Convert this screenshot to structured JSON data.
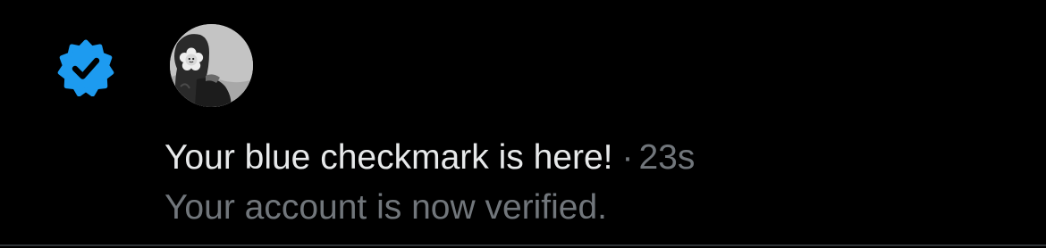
{
  "notification": {
    "icon": "verified-badge-icon",
    "avatar": "user-avatar",
    "title": "Your blue checkmark is here!",
    "separator": "·",
    "time": "23s",
    "body": "Your account is now verified."
  },
  "colors": {
    "background": "#000000",
    "badge": "#1d9bf0",
    "primary_text": "#e7e9ea",
    "secondary_text": "#71767b",
    "divider": "#2f3336"
  }
}
